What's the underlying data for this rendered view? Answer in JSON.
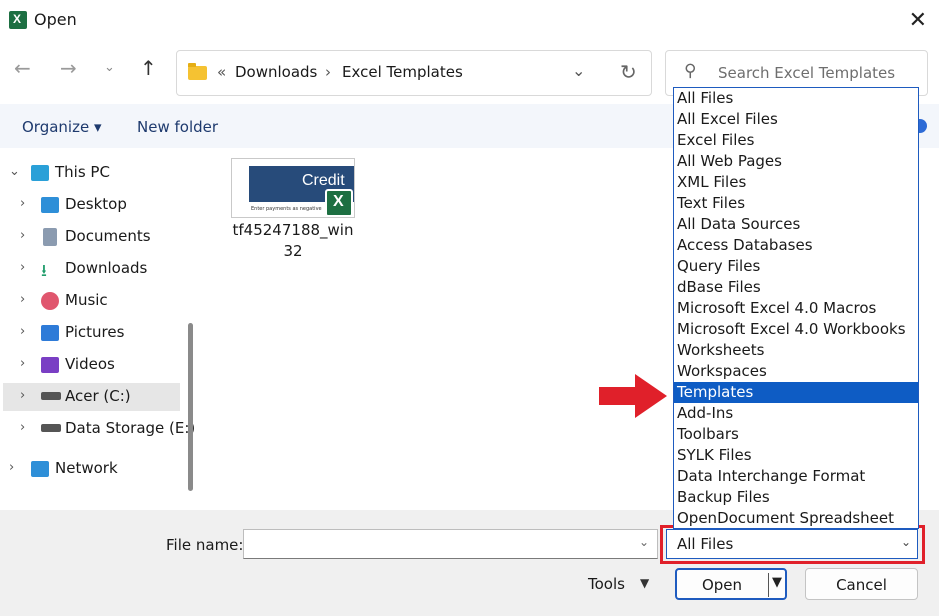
{
  "window": {
    "title": "Open"
  },
  "nav": {
    "breadcrumb_overflow": "«",
    "path": [
      "Downloads",
      "Excel Templates"
    ],
    "search_placeholder": "Search Excel Templates"
  },
  "toolbar": {
    "organize": "Organize",
    "new_folder": "New folder"
  },
  "sidebar": {
    "items": [
      {
        "label": "This PC",
        "icon": "computer-icon"
      },
      {
        "label": "Desktop",
        "icon": "desktop-icon"
      },
      {
        "label": "Documents",
        "icon": "documents-icon"
      },
      {
        "label": "Downloads",
        "icon": "downloads-icon"
      },
      {
        "label": "Music",
        "icon": "music-icon"
      },
      {
        "label": "Pictures",
        "icon": "pictures-icon"
      },
      {
        "label": "Videos",
        "icon": "videos-icon"
      },
      {
        "label": "Acer (C:)",
        "icon": "drive-icon"
      },
      {
        "label": "Data Storage (E:)",
        "icon": "drive-icon"
      },
      {
        "label": "Network",
        "icon": "network-icon"
      }
    ]
  },
  "files": [
    {
      "name_line1": "tf45247188_win",
      "name_line2": "32",
      "thumb_title": "Credit",
      "thumb_sub": "Enter payments as negative"
    }
  ],
  "file_type_dropdown": {
    "options": [
      "All Files",
      "All Excel Files",
      "Excel Files",
      "All Web Pages",
      "XML Files",
      "Text Files",
      "All Data Sources",
      "Access Databases",
      "Query Files",
      "dBase Files",
      "Microsoft Excel 4.0 Macros",
      "Microsoft Excel 4.0 Workbooks",
      "Worksheets",
      "Workspaces",
      "Templates",
      "Add-Ins",
      "Toolbars",
      "SYLK Files",
      "Data Interchange Format",
      "Backup Files",
      "OpenDocument Spreadsheet"
    ],
    "highlighted": "Templates",
    "selected_value": "All Files"
  },
  "footer": {
    "file_name_label": "File name:",
    "file_name_value": "",
    "tools_label": "Tools",
    "open_label": "Open",
    "cancel_label": "Cancel"
  },
  "colors": {
    "accent": "#0e5cc4",
    "highlight_red": "#e0202a",
    "arrow_red": "#e0202a"
  }
}
